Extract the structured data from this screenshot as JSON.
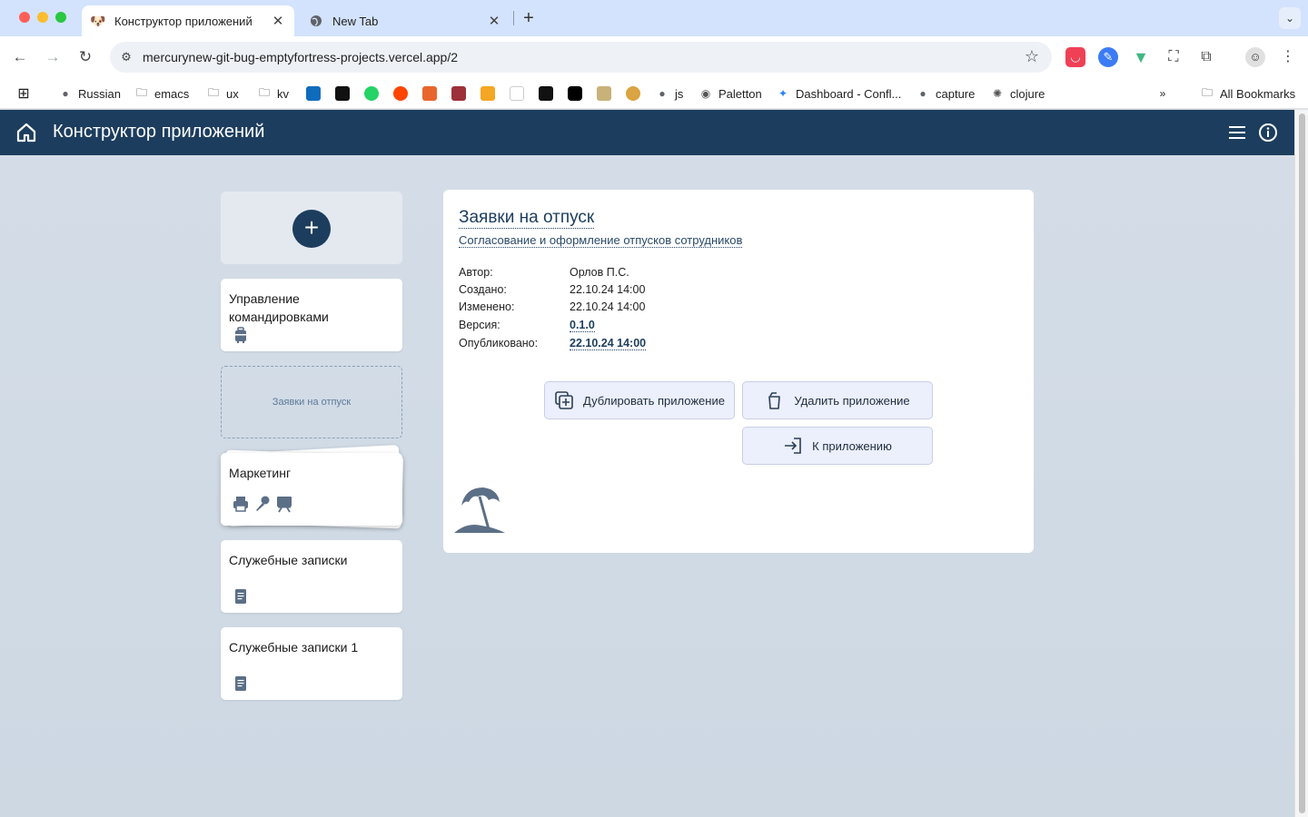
{
  "browser": {
    "tabs": [
      {
        "title": "Конструктор приложений",
        "active": true
      },
      {
        "title": "New Tab",
        "active": false
      }
    ],
    "url": "mercurynew-git-bug-emptyfortress-projects.vercel.app/2",
    "bookmarks": [
      "Russian",
      "emacs",
      "ux",
      "kv",
      "js",
      "Paletton",
      "Dashboard - Confl...",
      "capture",
      "clojure"
    ],
    "all_bookmarks": "All Bookmarks"
  },
  "app": {
    "title": "Конструктор приложений"
  },
  "sidebar": {
    "cards": [
      {
        "name": "Управление командировками",
        "icons": [
          "luggage-icon"
        ]
      },
      {
        "name": "Заявки на отпуск",
        "placeholder": true
      },
      {
        "name": "Маркетинг",
        "icons": [
          "printer-icon",
          "microphone-icon",
          "presentation-icon"
        ]
      },
      {
        "name": "Служебные записки",
        "icons": [
          "document-icon"
        ]
      },
      {
        "name": "Служебные записки 1",
        "icons": [
          "document-icon"
        ]
      }
    ]
  },
  "detail": {
    "title": "Заявки на отпуск",
    "description": "Согласование и оформление отпусков сотрудников",
    "meta": {
      "author_label": "Автор:",
      "author": "Орлов П.С.",
      "created_label": "Создано:",
      "created": "22.10.24 14:00",
      "modified_label": "Изменено:",
      "modified": "22.10.24 14:00",
      "version_label": "Версия:",
      "version": "0.1.0",
      "published_label": "Опубликовано:",
      "published": "22.10.24 14:00"
    },
    "buttons": {
      "duplicate": "Дублировать приложение",
      "delete": "Удалить приложение",
      "open": "К приложению"
    },
    "icon": "beach-umbrella-icon"
  }
}
